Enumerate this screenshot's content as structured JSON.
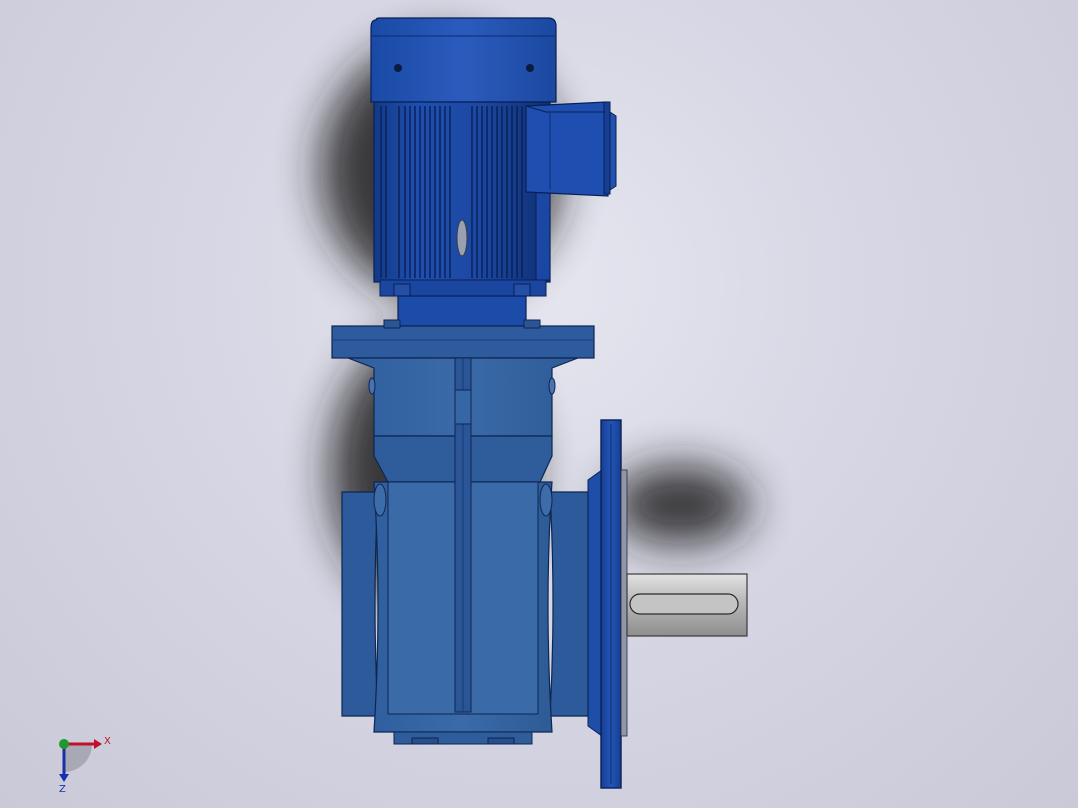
{
  "viewport": {
    "background": "#d3d3e1",
    "model_color": "#2d5fa8",
    "shaft_color": "#b9b9b9"
  },
  "triad": {
    "x_label": "X",
    "z_label": "Z",
    "x_color": "#c0102a",
    "y_color": "#1c9a2a",
    "z_color": "#1a2fa8"
  }
}
